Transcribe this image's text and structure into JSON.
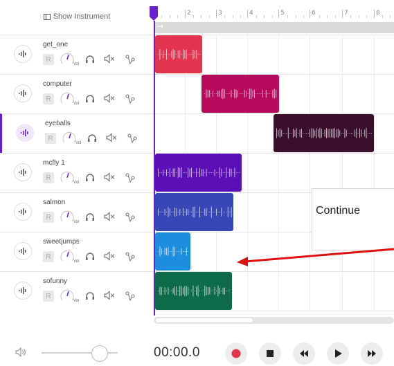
{
  "header": {
    "show_instrument_label": "Show Instrument",
    "bar_numbers": [
      "2",
      "3",
      "4",
      "5",
      "6",
      "7",
      "8"
    ],
    "loop_arrow": "→"
  },
  "tracks": [
    {
      "name": "get_one",
      "r_label": "R",
      "vol_label": "Vol",
      "selected": false
    },
    {
      "name": "computer",
      "r_label": "R",
      "vol_label": "Vol",
      "selected": false
    },
    {
      "name": "eyeballs",
      "r_label": "R",
      "vol_label": "Vol",
      "selected": true
    },
    {
      "name": "mcfly 1",
      "r_label": "R",
      "vol_label": "Vol",
      "selected": false
    },
    {
      "name": "salmon",
      "r_label": "R",
      "vol_label": "Vol",
      "selected": false
    },
    {
      "name": "sweetjumps",
      "r_label": "R",
      "vol_label": "Vol",
      "selected": false
    },
    {
      "name": "sofunny",
      "r_label": "R",
      "vol_label": "Vol",
      "selected": false
    }
  ],
  "clips": [
    {
      "track": "get_one",
      "color": "#e2344f"
    },
    {
      "track": "computer",
      "color": "#b8095c"
    },
    {
      "track": "eyeballs",
      "color": "#3a0e2c"
    },
    {
      "track": "mcfly 1",
      "color": "#5b0fb8"
    },
    {
      "track": "salmon",
      "color": "#3647b8"
    },
    {
      "track": "sweetjumps",
      "color": "#1d8de0"
    },
    {
      "track": "sofunny",
      "color": "#0e6b49"
    }
  ],
  "annotation": {
    "text": "Continue",
    "arrow_color": "#e01010"
  },
  "transport": {
    "time": "00:00.0",
    "record_color": "#e8334f",
    "icons": [
      "volume-icon",
      "record-icon",
      "stop-icon",
      "rewind-icon",
      "play-icon",
      "fast-forward-icon"
    ]
  },
  "colors": {
    "accent": "#6a1ed4"
  }
}
